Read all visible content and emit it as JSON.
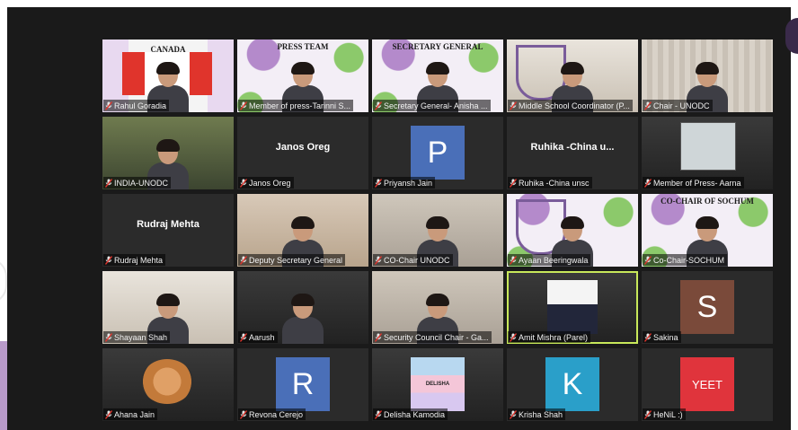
{
  "colors": {
    "tile_bg": "#2b2b2b",
    "active_border": "#c8e85a",
    "muted_mic": "#e0342c"
  },
  "participants": [
    {
      "label": "Rahul Goradia",
      "scene": "canada",
      "banner": "CANADA"
    },
    {
      "label": "Member of press-Tarinni S...",
      "scene": "press",
      "banner": "PRESS TEAM"
    },
    {
      "label": "Secretary General- Anisha ...",
      "scene": "secgen",
      "banner": "SECRETARY GENERAL"
    },
    {
      "label": "Middle School Coordinator (P...",
      "scene": "coordinator"
    },
    {
      "label": "Chair - UNODC",
      "scene": "chair"
    },
    {
      "label": "INDIA-UNODC",
      "scene": "india"
    },
    {
      "label": "Janos Oreg",
      "center_name": "Janos Oreg"
    },
    {
      "label": "Priyansh Jain",
      "avatar": "P",
      "avatar_color": "#4a6fb8"
    },
    {
      "label": "Ruhika -China unsc",
      "center_name": "Ruhika -China u..."
    },
    {
      "label": "Member of Press- Aarna",
      "scene": "aarna"
    },
    {
      "label": "Rudraj Mehta",
      "center_name": "Rudraj Mehta"
    },
    {
      "label": "Deputy Secretary General",
      "scene": "deputy"
    },
    {
      "label": "CO-Chair UNODC",
      "scene": "cochair"
    },
    {
      "label": "Ayaan Beeringwala",
      "scene": "ayaan"
    },
    {
      "label": "Co-Chair-SOCHUM",
      "scene": "sochum",
      "banner": "CO-CHAIR OF SOCHUM"
    },
    {
      "label": "Shayaan Shah",
      "scene": "shayaan"
    },
    {
      "label": "Aarush",
      "scene": "aarush"
    },
    {
      "label": "Security Council Chair - Ga...",
      "scene": "security"
    },
    {
      "label": "Amit Mishra (Parel)",
      "scene": "amit",
      "active": true
    },
    {
      "label": "Sakina",
      "avatar": "S",
      "avatar_color": "#7a4a3a"
    },
    {
      "label": "Ahana Jain",
      "scene": "cake"
    },
    {
      "label": "Revona Cerejo",
      "avatar": "R",
      "avatar_color": "#4a6fb8"
    },
    {
      "label": "Delisha Kamodia",
      "scene": "delisha",
      "avatar_text": "DELISHA"
    },
    {
      "label": "Krisha Shah",
      "avatar": "K",
      "avatar_color": "#2a9fc9"
    },
    {
      "label": "HeNiL :)",
      "avatar": "YEET",
      "avatar_color": "#e0343c",
      "avatar_small": true
    }
  ]
}
